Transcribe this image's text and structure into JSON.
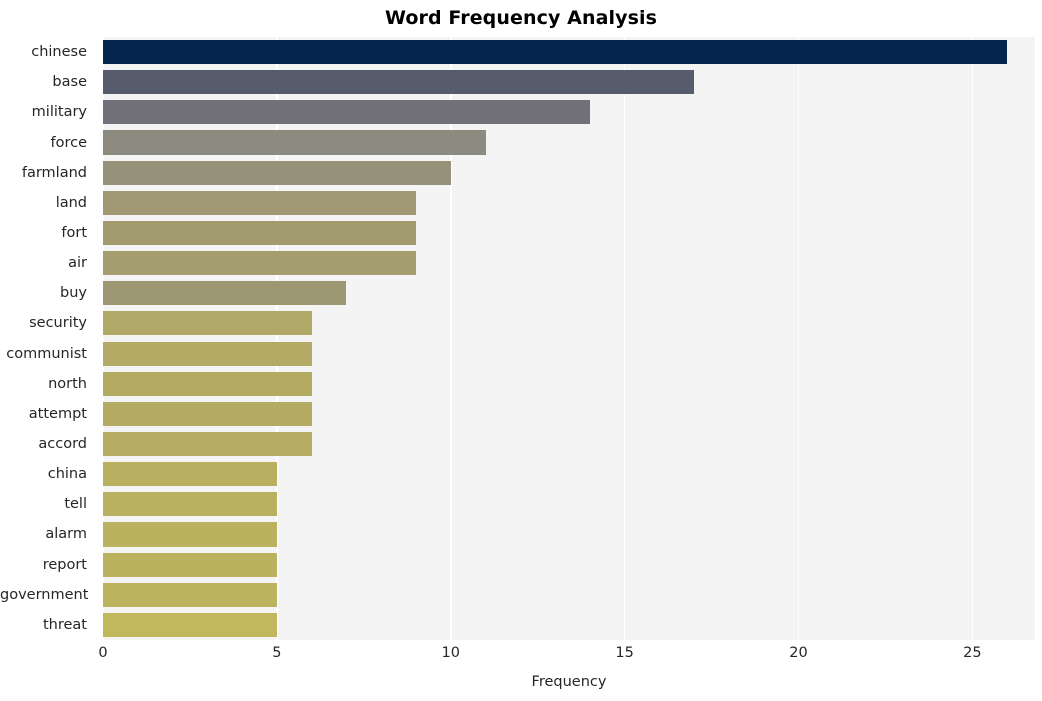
{
  "chart_data": {
    "type": "bar",
    "orientation": "horizontal",
    "title": "Word Frequency Analysis",
    "xlabel": "Frequency",
    "ylabel": "",
    "categories": [
      "chinese",
      "base",
      "military",
      "force",
      "farmland",
      "land",
      "fort",
      "air",
      "buy",
      "security",
      "communist",
      "north",
      "attempt",
      "accord",
      "china",
      "tell",
      "alarm",
      "report",
      "government",
      "threat"
    ],
    "values": [
      26,
      17,
      14,
      11,
      10,
      9,
      9,
      9,
      7,
      6,
      6,
      6,
      6,
      6,
      5,
      5,
      5,
      5,
      5,
      5
    ],
    "bar_colors": [
      "#04254e",
      "#575c6d",
      "#72717a",
      "#8d8a7f",
      "#97927a",
      "#9f9873",
      "#a29b70",
      "#a49d6e",
      "#ab a36a",
      "#b0a866",
      "#b2aa65",
      "#b3ab64",
      "#b4ac64",
      "#b5ad63",
      "#b8b060",
      "#b9b15f",
      "#bab25e",
      "#bab25e",
      "#bbb35d",
      "#c0b85a"
    ],
    "xlim": [
      0,
      26.8
    ],
    "xticks": [
      0,
      5,
      10,
      15,
      20,
      25
    ],
    "xtick_labels": [
      "0",
      "5",
      "10",
      "15",
      "20",
      "25"
    ],
    "grid": "vertical",
    "legend": "none",
    "plot_background": "#f4f4f5",
    "grid_color": "#ffffff",
    "figure_background": "#ffffff",
    "text_color": "#262626",
    "title_color": "#000000"
  }
}
